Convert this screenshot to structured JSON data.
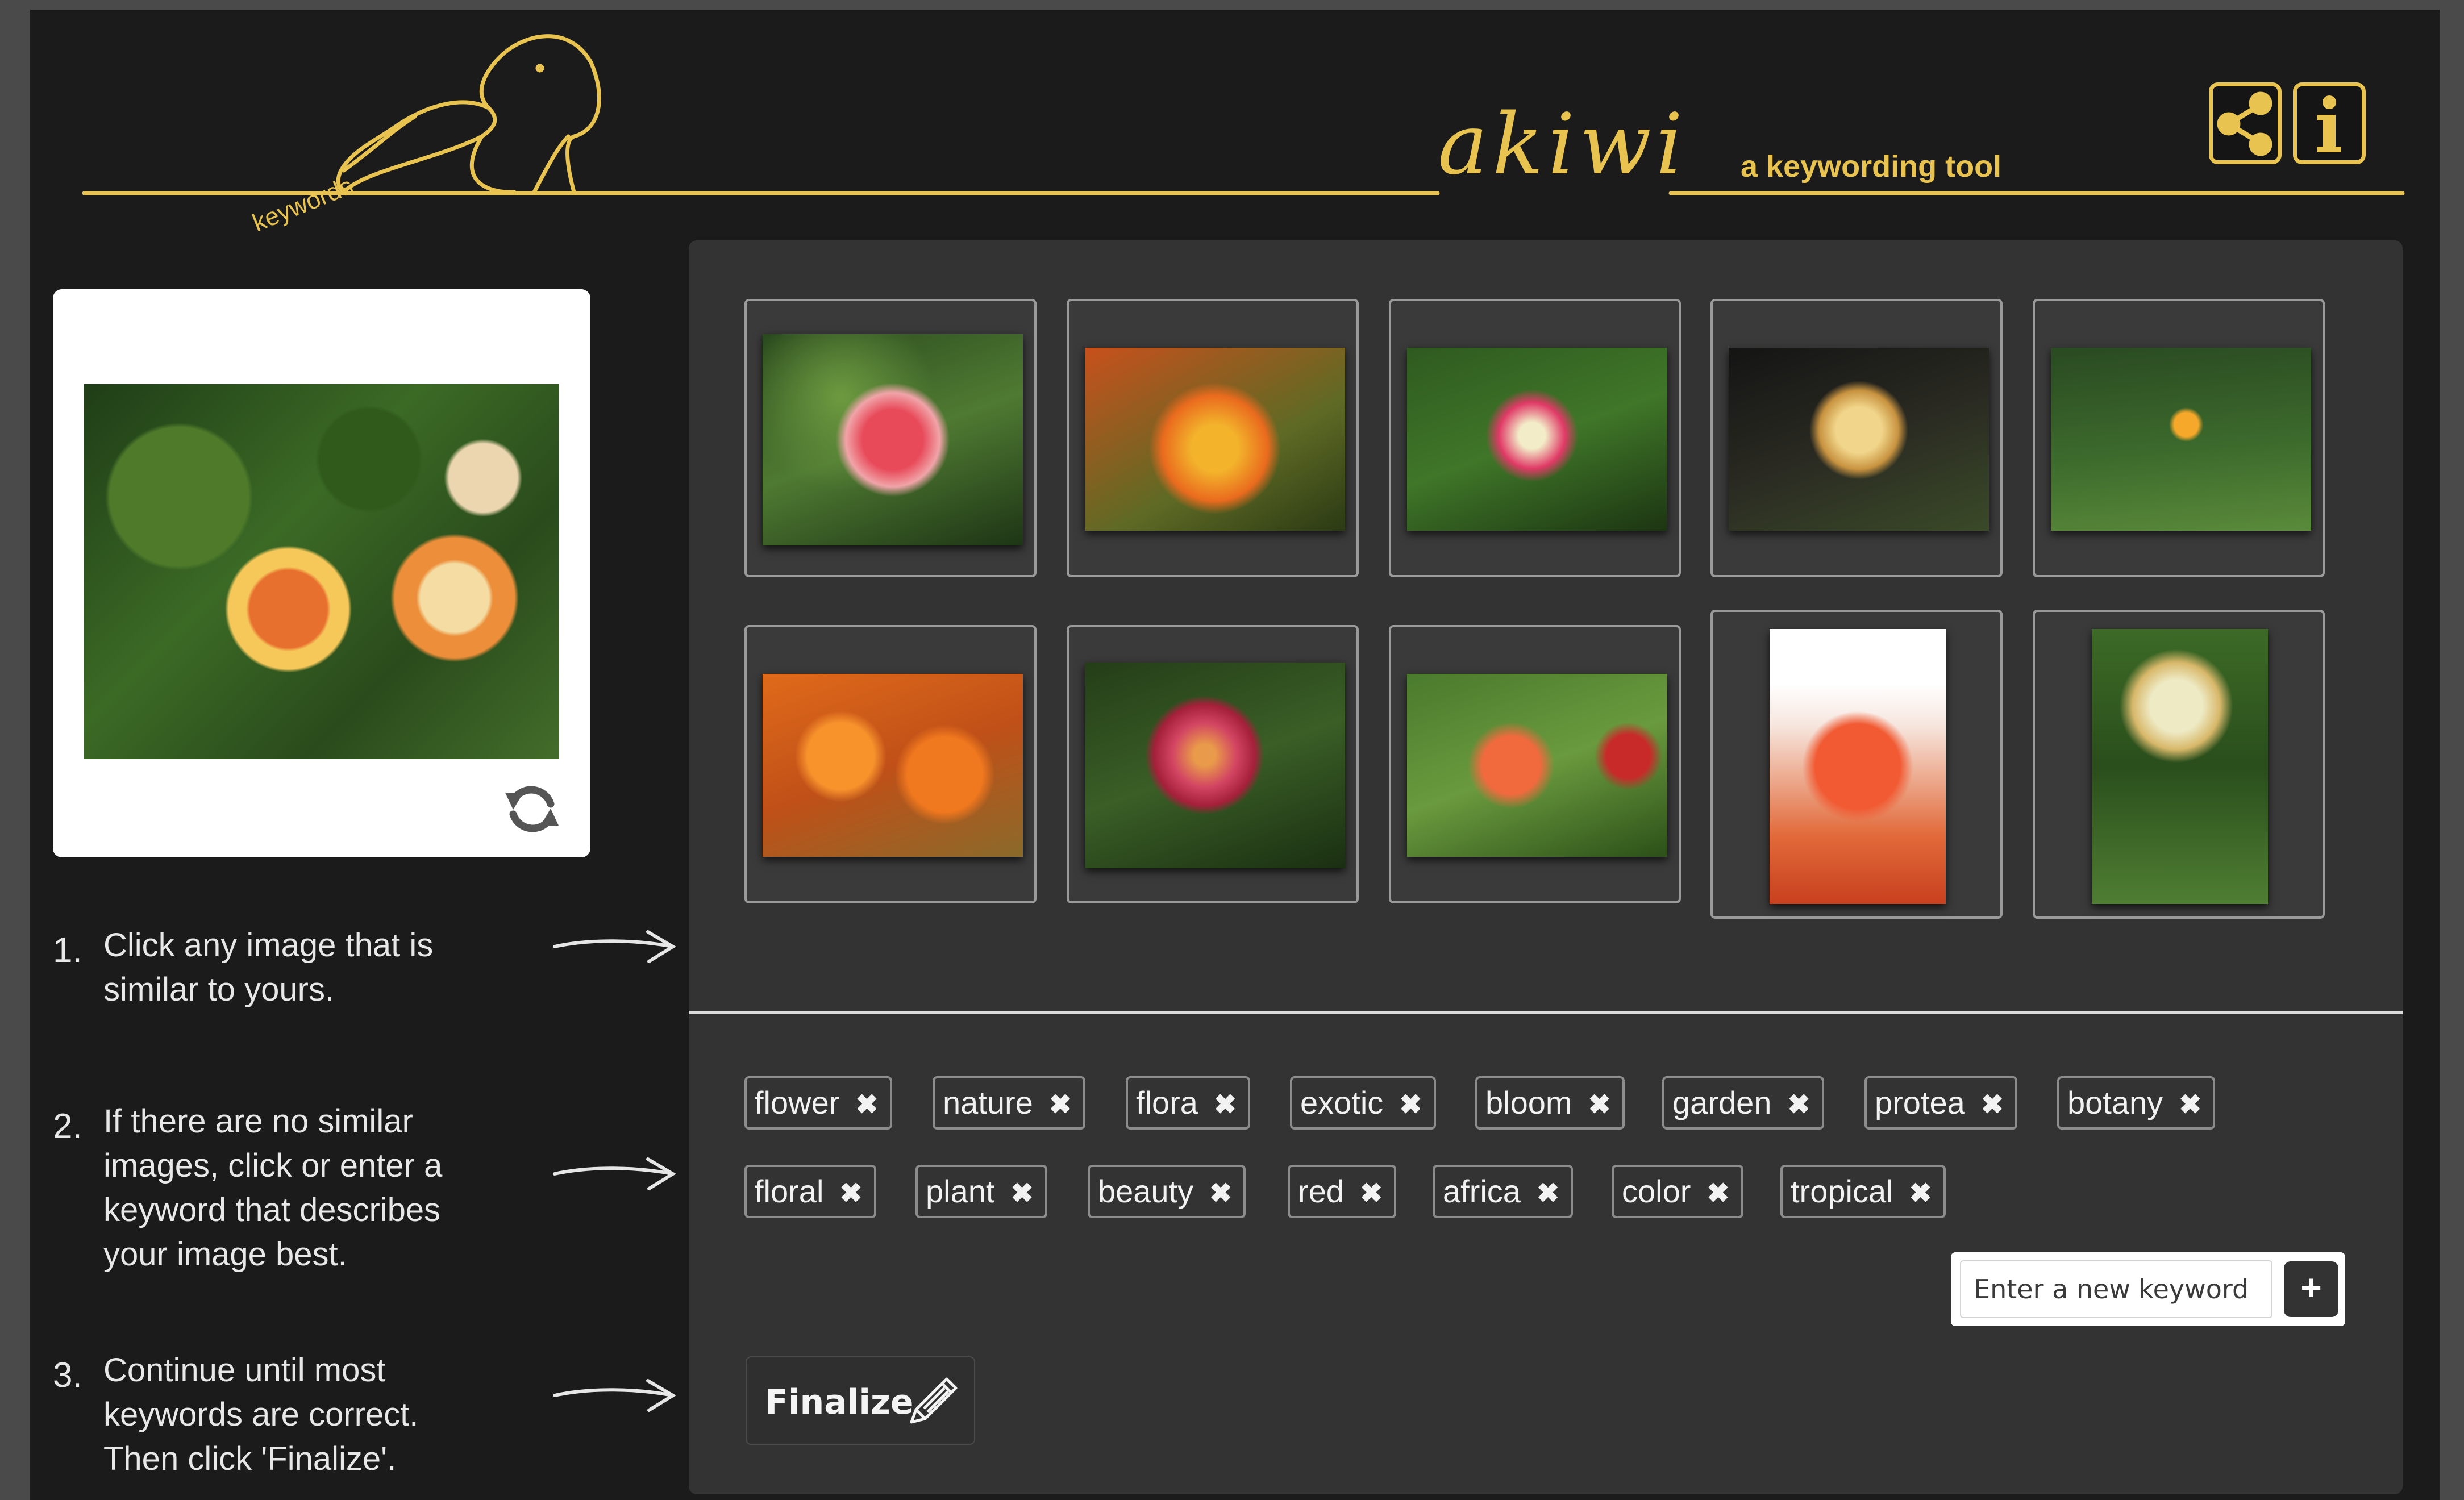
{
  "header": {
    "brand_name": "akiwi",
    "tagline": "a keywording tool",
    "logo_caption": "keywords",
    "accent_color": "#e8c34f",
    "share_button_icon": "share-icon",
    "info_button_icon": "info-icon"
  },
  "source_image": {
    "refresh_icon": "refresh-icon"
  },
  "instructions": [
    {
      "number": "1.",
      "text": "Click any image that is similar to yours."
    },
    {
      "number": "2.",
      "text": "If there are no similar images, click or enter a keyword that describes your image best."
    },
    {
      "number": "3.",
      "text": "Continue until most keywords are correct. Then click 'Finalize'."
    }
  ],
  "similar_images": {
    "count": 10
  },
  "keywords": {
    "tags": [
      "flower",
      "nature",
      "flora",
      "exotic",
      "bloom",
      "garden",
      "protea",
      "botany",
      "floral",
      "plant",
      "beauty",
      "red",
      "africa",
      "color",
      "tropical"
    ],
    "remove_symbol": "✖",
    "input_placeholder": "Enter a new keyword",
    "add_symbol": "+"
  },
  "finalize": {
    "label": "Finalize",
    "icon": "pencil-icon"
  }
}
